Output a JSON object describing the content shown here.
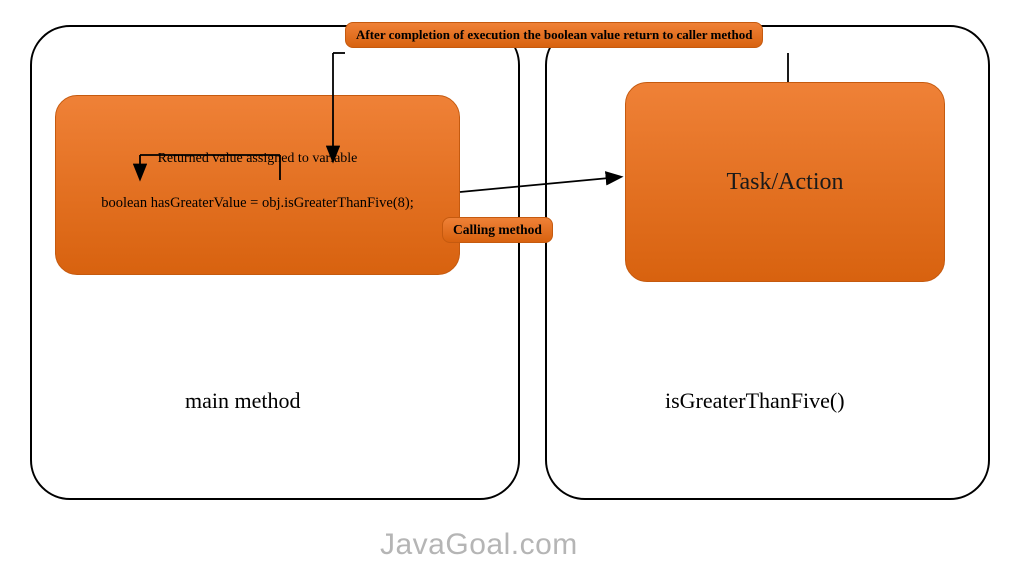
{
  "diagram": {
    "left_container_title": "main method",
    "right_container_title": "isGreaterThanFive()",
    "code_box": {
      "inner_label": "Returned value assigned to variable",
      "code": "boolean hasGreaterValue = obj.isGreaterThanFive(8);"
    },
    "task_box_label": "Task/Action",
    "top_label": "After completion of execution the boolean value return to caller method",
    "calling_label": "Calling method",
    "watermark": "JavaGoal.com"
  }
}
